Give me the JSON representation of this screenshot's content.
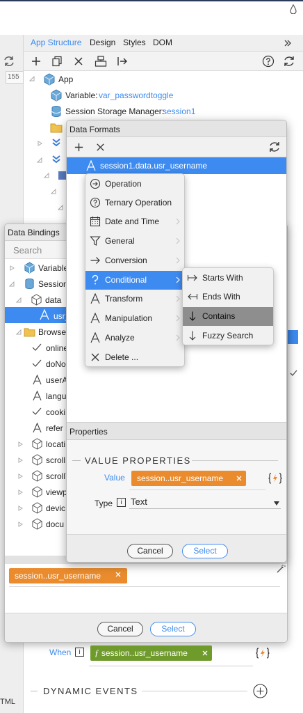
{
  "top": {
    "tabs": [
      "App Structure",
      "Design",
      "Styles",
      "DOM"
    ],
    "ruler_value": "155"
  },
  "tree": {
    "items": [
      {
        "label": "App",
        "value": ""
      },
      {
        "label": "Variable:",
        "value": "var_passwordtoggle"
      },
      {
        "label": "Session Storage Manager:",
        "value": "session1"
      }
    ]
  },
  "data_formats": {
    "title": "Data Formats",
    "selected_item": "session1.data.usr_username",
    "properties_title": "Properties",
    "section_title": "VALUE PROPERTIES",
    "value_label": "Value",
    "value_tag": "session..usr_username",
    "type_label": "Type",
    "type_value": "Text",
    "cancel_label": "Cancel",
    "select_label": "Select"
  },
  "context_menu": {
    "items": [
      {
        "label": "Operation",
        "icon": "operation-icon"
      },
      {
        "label": "Ternary Operation",
        "icon": "question-circle-icon"
      },
      {
        "label": "Date and Time",
        "icon": "calendar-icon"
      },
      {
        "label": "General",
        "icon": "funnel-icon"
      },
      {
        "label": "Conversion",
        "icon": "arrow-right-icon"
      },
      {
        "label": "Conditional",
        "icon": "question-mark-icon"
      },
      {
        "label": "Transform",
        "icon": "text-a-icon"
      },
      {
        "label": "Manipulation",
        "icon": "text-a-icon"
      },
      {
        "label": "Analyze",
        "icon": "text-a-icon"
      },
      {
        "label": "Delete ...",
        "icon": "close-icon"
      }
    ],
    "active_index": 5
  },
  "sub_menu": {
    "items": [
      {
        "label": "Starts With",
        "icon": "starts-with-icon"
      },
      {
        "label": "Ends With",
        "icon": "ends-with-icon"
      },
      {
        "label": "Contains",
        "icon": "contains-icon"
      },
      {
        "label": "Fuzzy Search",
        "icon": "fuzzy-search-icon"
      }
    ],
    "active_index": 2
  },
  "data_bindings": {
    "title": "Data Bindings",
    "search_placeholder": "Search",
    "items": [
      "Variable",
      "Session",
      "data",
      "usr_",
      "Browse",
      "online",
      "doNo",
      "userA",
      "langu",
      "cooki",
      "refer",
      "locati",
      "scroll",
      "scrollY",
      "viewp",
      "devic",
      "docu"
    ],
    "value_tag": "session..usr_username",
    "cancel_label": "Cancel",
    "select_label": "Select"
  },
  "bottom": {
    "when_label": "When",
    "when_tag": "session..usr_username",
    "dynamic_events": "DYNAMIC EVENTS",
    "left_fragment": "TML"
  },
  "colors": {
    "accent": "#3d8bf0",
    "orange_tag": "#ea8c2e",
    "green_tag": "#6f9a2c"
  }
}
